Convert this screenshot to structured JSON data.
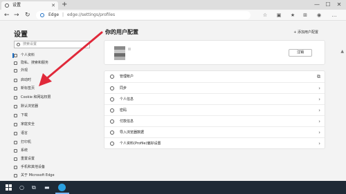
{
  "browser": {
    "tab_title": "设置",
    "edge_label": "Edge",
    "url_separator": "|",
    "url": "edge://settings/profiles"
  },
  "sidebar": {
    "title": "设置",
    "search_placeholder": "搜索设置",
    "items": [
      {
        "label": "个人资料",
        "icon": "person-icon",
        "active": true
      },
      {
        "label": "隐私、搜索和服务",
        "icon": "lock-icon"
      },
      {
        "label": "外观",
        "icon": "palette-icon"
      },
      {
        "label": "启动时",
        "icon": "power-icon"
      },
      {
        "label": "新标签页",
        "icon": "newtab-icon"
      },
      {
        "label": "Cookie 和网站权限",
        "icon": "cookie-icon"
      },
      {
        "label": "默认浏览器",
        "icon": "browser-icon"
      },
      {
        "label": "下载",
        "icon": "download-icon"
      },
      {
        "label": "家庭安全",
        "icon": "family-icon"
      },
      {
        "label": "语言",
        "icon": "language-icon"
      },
      {
        "label": "打印机",
        "icon": "printer-icon"
      },
      {
        "label": "系统",
        "icon": "system-icon"
      },
      {
        "label": "重置设置",
        "icon": "reset-icon"
      },
      {
        "label": "手机和其他设备",
        "icon": "phone-icon"
      },
      {
        "label": "关于 Microsoft Edge",
        "icon": "edge-icon"
      }
    ]
  },
  "main": {
    "title": "你的用户配置",
    "add_profile": "+ 添加用户配置",
    "sign_out": "注销",
    "rows": [
      {
        "label": "管理帐户",
        "icon": "account-icon",
        "trailing": "external-link-icon"
      },
      {
        "label": "同步",
        "icon": "sync-icon"
      },
      {
        "label": "个人信息",
        "icon": "person-info-icon"
      },
      {
        "label": "密码",
        "icon": "key-icon"
      },
      {
        "label": "付款信息",
        "icon": "card-icon"
      },
      {
        "label": "导入浏览器数据",
        "icon": "import-icon"
      },
      {
        "label": "个人资料(Profile)偏好设置",
        "icon": "profile-prefs-icon"
      }
    ]
  },
  "colors": {
    "accent": "#1e6fc4",
    "annotation_arrow": "#e0293a",
    "taskbar": "#1f2a36"
  }
}
